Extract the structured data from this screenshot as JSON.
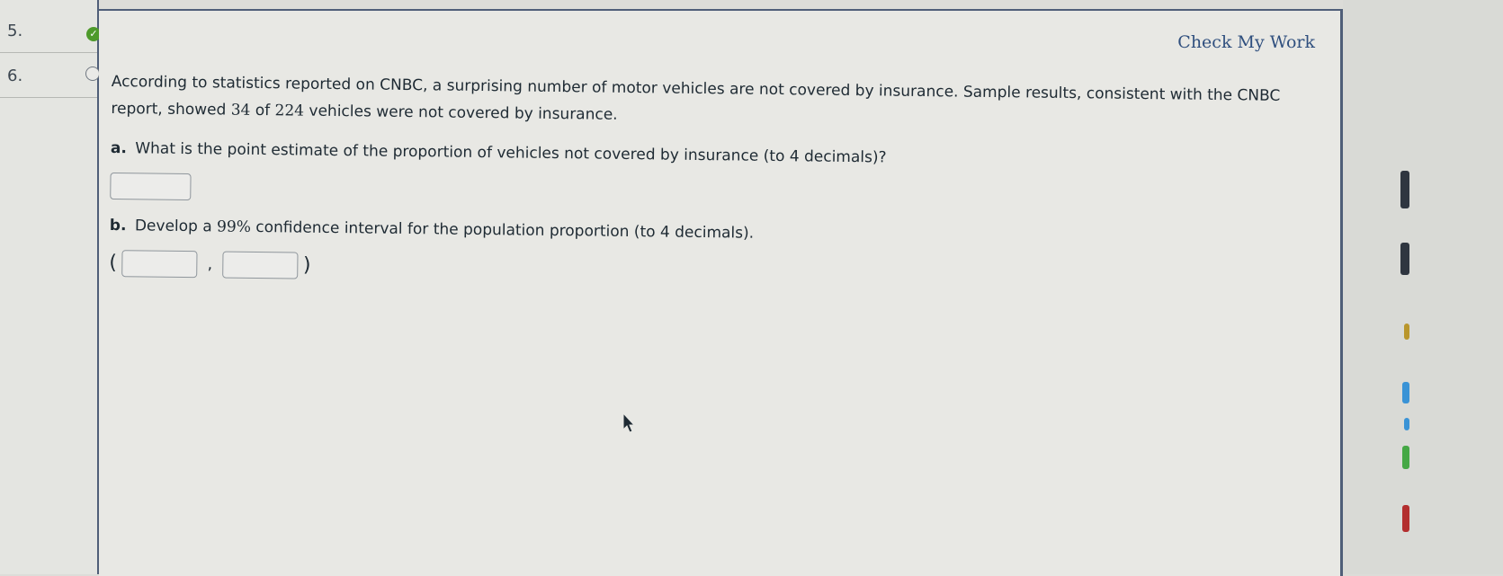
{
  "nav": {
    "items": [
      {
        "number": "5.",
        "status": "completed"
      },
      {
        "number": "6.",
        "status": "unanswered"
      }
    ]
  },
  "header": {
    "check_my_work": "Check My Work"
  },
  "question": {
    "intro_pre": "According to statistics reported on CNBC, a surprising number of motor vehicles are not covered by insurance. Sample results, consistent with the CNBC report, showed ",
    "count": "34",
    "of_text": " of ",
    "sample_size": "224",
    "intro_post": " vehicles were not covered by insurance.",
    "part_a": {
      "letter": "a.",
      "text": "What is the point estimate of the proportion of vehicles not covered by insurance (to 4 decimals)?",
      "answer_value": ""
    },
    "part_b": {
      "letter": "b.",
      "text_pre": "Develop a ",
      "confidence": "99%",
      "text_post": " confidence interval for the population proportion (to 4 decimals).",
      "open_paren": "(",
      "separator": ",",
      "close_paren": ")",
      "lower_value": "",
      "upper_value": ""
    }
  },
  "icons": {
    "completed": "check-circle-icon",
    "unanswered": "empty-circle-icon",
    "cursor": "mouse-pointer-icon"
  },
  "colors": {
    "accent": "#4f5e78",
    "link": "#2f4f7e",
    "completed": "#4e9a2b"
  }
}
